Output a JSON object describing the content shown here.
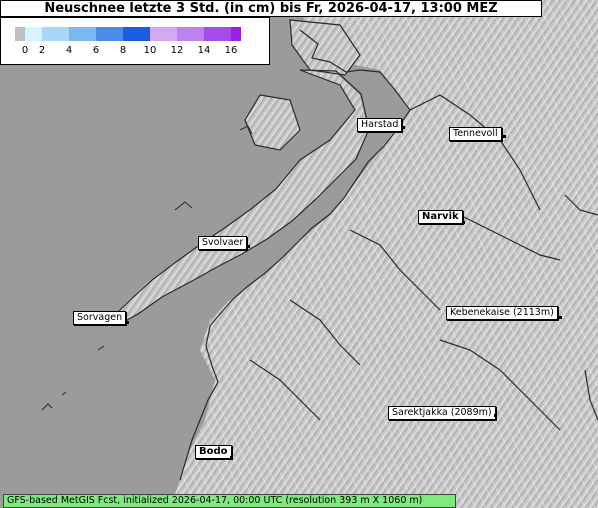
{
  "title": "Neuschnee letzte 3 Std. (in cm) bis Fr, 2026-04-17, 13:00 MEZ",
  "legend": {
    "ticks": [
      "0",
      "2",
      "4",
      "6",
      "8",
      "10",
      "12",
      "14",
      "16"
    ],
    "colors": [
      "#bfbfbf",
      "#d6f4ff",
      "#a8d8f8",
      "#7ab8f0",
      "#4a8ce8",
      "#1a5ee0",
      "#d2a8f0",
      "#bf80f0",
      "#a84ce8",
      "#9b1fe8"
    ]
  },
  "places": [
    {
      "name": "Harstad",
      "bold": false
    },
    {
      "name": "Tennevoll",
      "bold": false
    },
    {
      "name": "Narvik",
      "bold": true
    },
    {
      "name": "Svolvaer",
      "bold": false
    },
    {
      "name": "Sorvagen",
      "bold": false
    },
    {
      "name": "Kebenekaise (2113m)",
      "bold": false
    },
    {
      "name": "Sarektjakka (2089m)",
      "bold": false
    },
    {
      "name": "Bodo",
      "bold": true
    }
  ],
  "footer": "GFS-based MetGIS Fcst, initialized 2026-04-17, 00:00 UTC  (resolution 393 m X 1060 m)",
  "colors": {
    "sea": "#9b9b9b",
    "land": "#c8c8c8",
    "coast": "#2a2a2a",
    "footer_bg": "#7fe87f"
  }
}
